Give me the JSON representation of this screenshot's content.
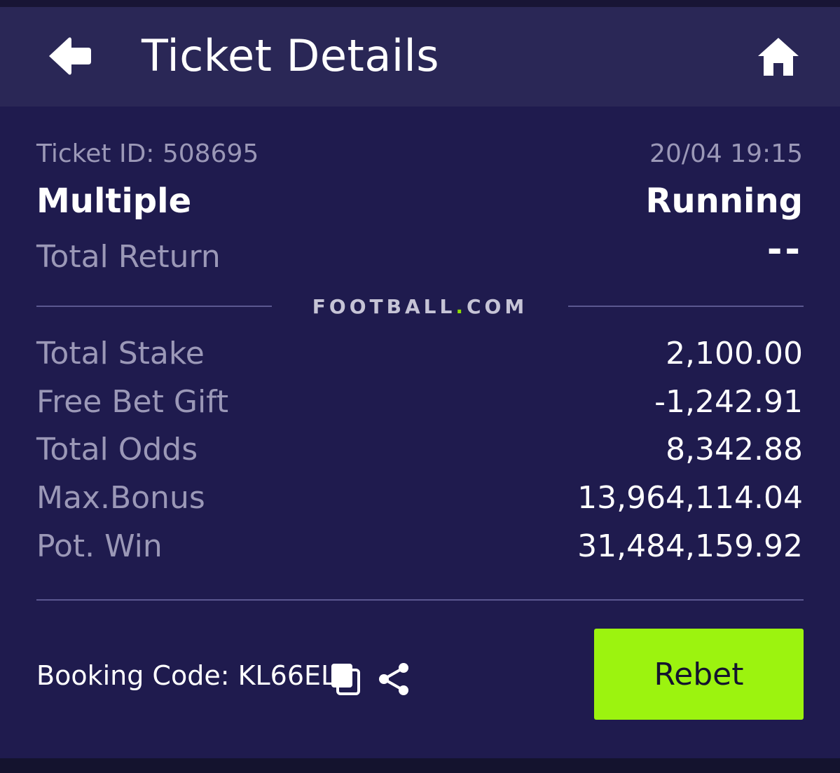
{
  "header": {
    "title": "Ticket Details",
    "back_icon": "arrow-left-icon",
    "home_icon": "home-icon"
  },
  "ticket": {
    "id_label": "Ticket ID: 508695",
    "datetime": "20/04 19:15",
    "bet_type": "Multiple",
    "status": "Running",
    "total_return_label": "Total Return",
    "total_return_value": "--"
  },
  "brand": {
    "text_left": "FOOTBALL",
    "dot": ".",
    "text_right": "COM",
    "dot_color": "#8ee000"
  },
  "details": [
    {
      "label": "Total Stake",
      "value": "2,100.00"
    },
    {
      "label": "Free Bet Gift",
      "value": "-1,242.91"
    },
    {
      "label": "Total Odds",
      "value": "8,342.88"
    },
    {
      "label": "Max.Bonus",
      "value": "13,964,114.04"
    },
    {
      "label": "Pot. Win",
      "value": "31,484,159.92"
    }
  ],
  "footer": {
    "booking_code_label": "Booking Code: KL66EL",
    "copy_icon": "copy-icon",
    "share_icon": "share-icon",
    "rebet_label": "Rebet",
    "rebet_color": "#9cf30f"
  },
  "colors": {
    "background": "#1f1b4e",
    "header": "#2a2756",
    "muted_text": "#9b98b7"
  }
}
